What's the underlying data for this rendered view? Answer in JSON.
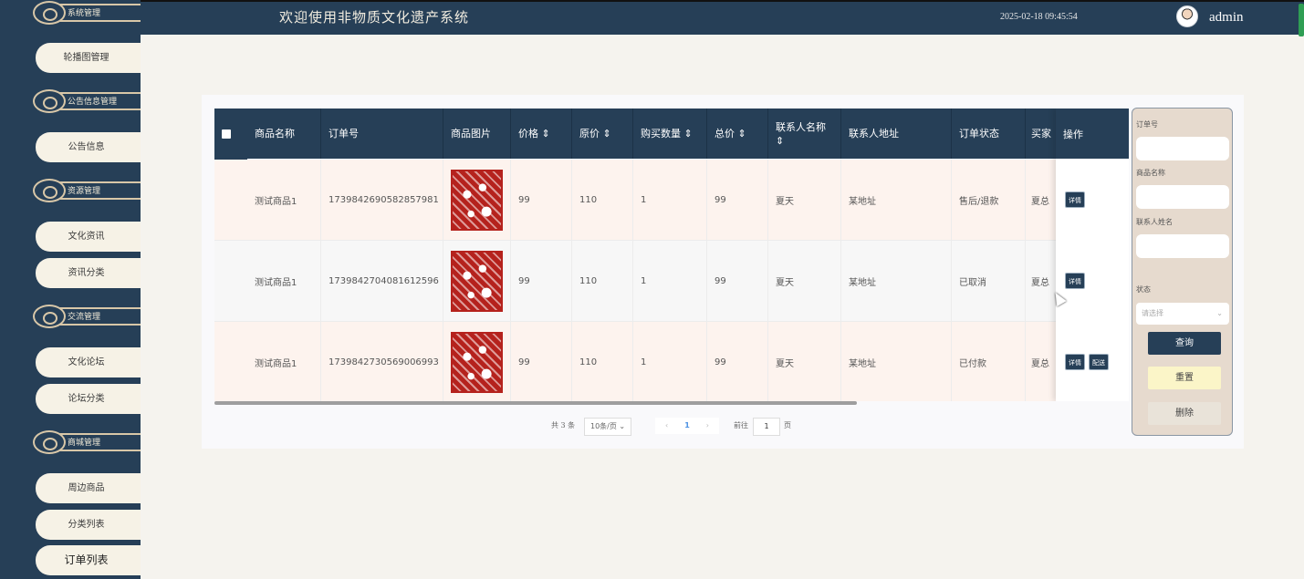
{
  "header": {
    "title": "欢迎使用非物质文化遗产系统",
    "datetime": "2025-02-18 09:45:54",
    "username": "admin"
  },
  "sidebar": {
    "categories": [
      {
        "label": "系统管理"
      },
      {
        "label": "公告信息管理"
      },
      {
        "label": "资源管理"
      },
      {
        "label": "交流管理"
      },
      {
        "label": "商城管理"
      }
    ],
    "items": [
      {
        "label": "轮播图管理"
      },
      {
        "label": "公告信息"
      },
      {
        "label": "文化资讯"
      },
      {
        "label": "资讯分类"
      },
      {
        "label": "文化论坛"
      },
      {
        "label": "论坛分类"
      },
      {
        "label": "周边商品"
      },
      {
        "label": "分类列表"
      },
      {
        "label": "订单列表"
      }
    ]
  },
  "table": {
    "headers": {
      "name": "商品名称",
      "order_no": "订单号",
      "image": "商品图片",
      "price": "价格 ⇕",
      "orig_price": "原价 ⇕",
      "qty": "购买数量 ⇕",
      "total": "总价 ⇕",
      "contact_name_1": "联系人名称",
      "contact_name_2": "⇕",
      "address": "联系人地址",
      "status": "订单状态",
      "buyer": "买家",
      "ops": "操作"
    },
    "rows": [
      {
        "name": "测试商品1",
        "order_no": "1739842690582857981",
        "price": "99",
        "orig_price": "110",
        "qty": "1",
        "total": "99",
        "contact": "夏天",
        "address": "某地址",
        "status": "售后/退款",
        "buyer": "夏总",
        "actions": [
          "详情"
        ]
      },
      {
        "name": "测试商品1",
        "order_no": "1739842704081612596",
        "price": "99",
        "orig_price": "110",
        "qty": "1",
        "total": "99",
        "contact": "夏天",
        "address": "某地址",
        "status": "已取消",
        "buyer": "夏总",
        "actions": [
          "详情"
        ]
      },
      {
        "name": "测试商品1",
        "order_no": "1739842730569006993",
        "price": "99",
        "orig_price": "110",
        "qty": "1",
        "total": "99",
        "contact": "夏天",
        "address": "某地址",
        "status": "已付款",
        "buyer": "夏总",
        "actions": [
          "详情",
          "配送"
        ]
      }
    ]
  },
  "pagination": {
    "total_text": "共 3 条",
    "page_size": "10条/页 ⌄",
    "prev": "‹",
    "current": "1",
    "next": "›",
    "goto_label": "前往",
    "goto_value": "1",
    "goto_suffix": "页"
  },
  "search": {
    "order_no_label": "订单号",
    "product_name_label": "商品名称",
    "contact_name_label": "联系人姓名",
    "status_label": "状态",
    "status_placeholder": "请选择",
    "status_chevron": "⌄",
    "query_button": "查询",
    "reset_button": "重置",
    "delete_button": "删除"
  },
  "colors": {
    "nav": "#263f57",
    "background": "#f5f3ee",
    "highlight_row": "#fdf3ee",
    "reset_button": "#fbf5c8"
  }
}
